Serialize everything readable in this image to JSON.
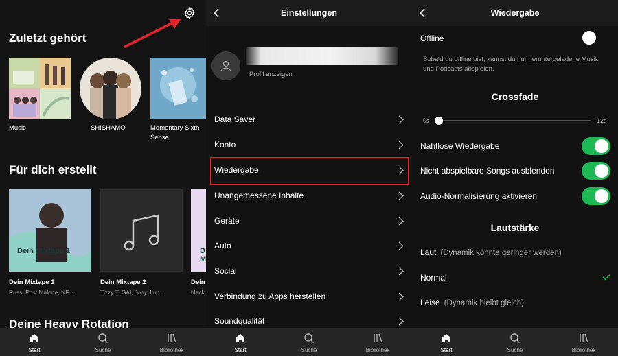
{
  "colors": {
    "accent_green": "#1db954",
    "highlight_red": "#e5262a",
    "background": "#121212"
  },
  "bottom_nav": [
    {
      "label": "Start",
      "icon": "home-icon",
      "active": true
    },
    {
      "label": "Suche",
      "icon": "search-icon",
      "active": false
    },
    {
      "label": "Bibliothek",
      "icon": "library-icon",
      "active": false
    }
  ],
  "home": {
    "recent_title": "Zuletzt gehört",
    "recent": [
      {
        "label": "Music"
      },
      {
        "label": "SHISHAMO"
      },
      {
        "label": "Momentary Sixth Sense"
      }
    ],
    "made_for_you_title": "Für dich erstellt",
    "made_for_you": [
      {
        "cover_text": "Dein Mixtape 1",
        "title": "Dein Mixtape 1",
        "subtitle": "Russ, Post Malone, NF..."
      },
      {
        "cover_text": "",
        "title": "Dein Mixtape 2",
        "subtitle": "Tizzy T, GAI, Jony J un..."
      },
      {
        "cover_text": "D M",
        "title": "Dein",
        "subtitle": "black"
      }
    ],
    "heavy_rotation_title": "Deine Heavy Rotation"
  },
  "settings": {
    "title": "Einstellungen",
    "profile_link": "Profil anzeigen",
    "items": [
      {
        "label": "Data Saver"
      },
      {
        "label": "Konto"
      },
      {
        "label": "Wiedergabe"
      },
      {
        "label": "Unangemessene Inhalte"
      },
      {
        "label": "Geräte"
      },
      {
        "label": "Auto"
      },
      {
        "label": "Social"
      },
      {
        "label": "Verbindung zu Apps herstellen"
      },
      {
        "label": "Soundqualität"
      }
    ]
  },
  "playback": {
    "title": "Wiedergabe",
    "offline_label": "Offline",
    "offline_on": false,
    "offline_desc": "Sobald du offline bist, kannst du nur heruntergeladene Musik und Podcasts abspielen.",
    "crossfade_title": "Crossfade",
    "crossfade_min": "0s",
    "crossfade_max": "12s",
    "crossfade_value": 0,
    "toggles": [
      {
        "label": "Nahtlose Wiedergabe",
        "on": true
      },
      {
        "label": "Nicht abspielbare Songs ausblenden",
        "on": true
      },
      {
        "label": "Audio-Normalisierung aktivieren",
        "on": true
      }
    ],
    "volume_title": "Lautstärke",
    "volume_options": [
      {
        "label": "Laut",
        "hint": "(Dynamik könnte geringer werden)",
        "selected": false
      },
      {
        "label": "Normal",
        "hint": "",
        "selected": true
      },
      {
        "label": "Leise",
        "hint": "(Dynamik bleibt gleich)",
        "selected": false
      }
    ]
  }
}
